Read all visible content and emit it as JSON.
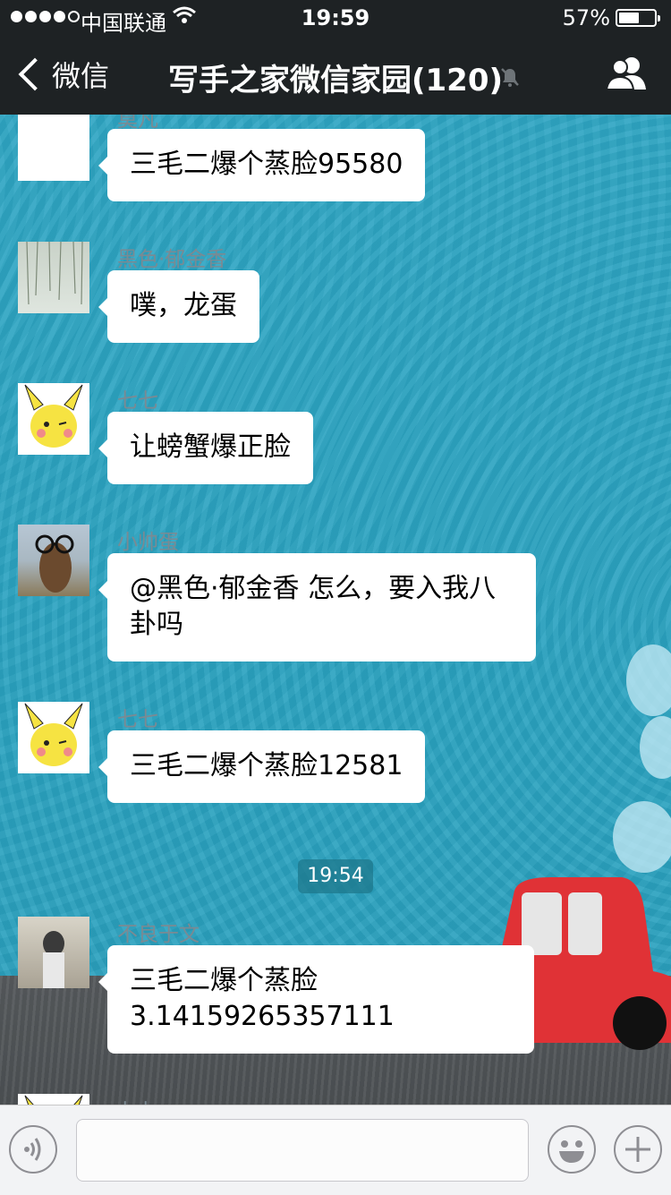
{
  "status_bar": {
    "carrier": "中国联通",
    "time": "19:59",
    "battery": "57%",
    "battery_level": 0.57
  },
  "nav": {
    "back_label": "微信",
    "title": "写手之家微信家园(120)"
  },
  "messages": [
    {
      "sender": "莫凡",
      "text": "三毛二爆个蒸脸95580"
    },
    {
      "sender": "黑色·郁金香",
      "text": "噗，龙蛋"
    },
    {
      "sender": "七七",
      "text": "让螃蟹爆正脸"
    },
    {
      "sender": "小帅蛋",
      "text": "@黑色·郁金香 怎么，要入我八卦吗"
    },
    {
      "sender": "七七",
      "text": "三毛二爆个蒸脸12581"
    },
    {
      "sender": "不良于文",
      "text": "三毛二爆个蒸脸3.14159265357111"
    },
    {
      "sender": "七七",
      "text": ""
    }
  ],
  "timestamp": "19:54",
  "input": {
    "value": ""
  },
  "icons": {
    "back": "chevron-left-icon",
    "mute": "bell-muted-icon",
    "group": "group-members-icon",
    "voice": "voice-icon",
    "emoji": "smiley-icon",
    "plus": "plus-icon"
  },
  "colors": {
    "nav_bg": "#1e2224",
    "chat_bg": "#2aa3c2",
    "bubble": "#ffffff"
  }
}
